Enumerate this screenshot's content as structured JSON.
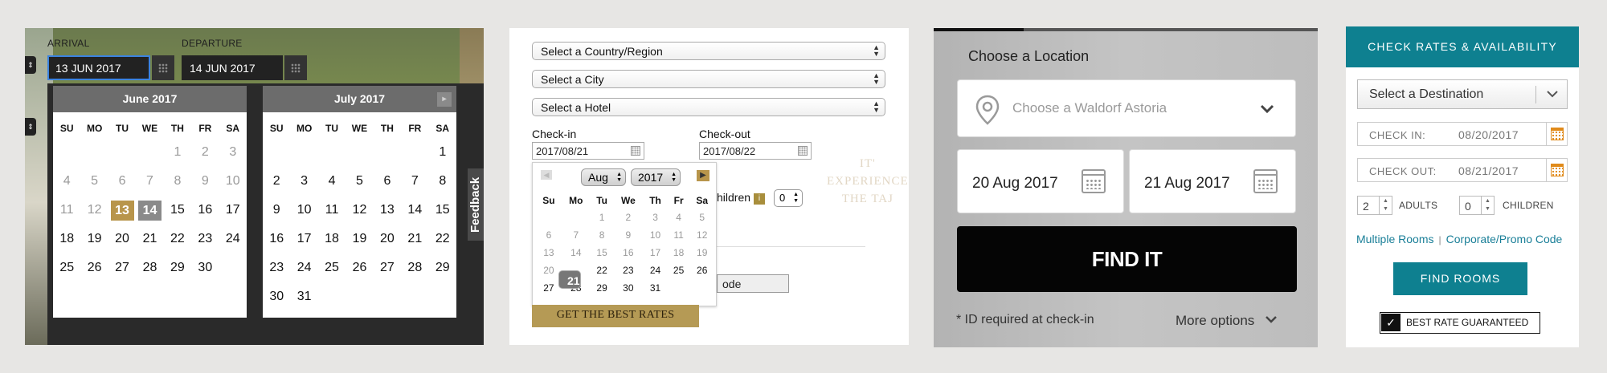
{
  "panel1": {
    "arrival_label": "ARRIVAL",
    "departure_label": "DEPARTURE",
    "arrival_value": "13 JUN 2017",
    "departure_value": "14 JUN 2017",
    "side_tab_glyph": "⇕",
    "feedback_label": "Feedback",
    "weekdays": [
      "SU",
      "MO",
      "TU",
      "WE",
      "TH",
      "FR",
      "SA"
    ],
    "june": {
      "title": "June 2017",
      "rows": [
        [
          "",
          "",
          "",
          "",
          "1",
          "2",
          "3"
        ],
        [
          "4",
          "5",
          "6",
          "7",
          "8",
          "9",
          "10"
        ],
        [
          "11",
          "12",
          "13",
          "14",
          "15",
          "16",
          "17"
        ],
        [
          "18",
          "19",
          "20",
          "21",
          "22",
          "23",
          "24"
        ],
        [
          "25",
          "26",
          "27",
          "28",
          "29",
          "30",
          ""
        ]
      ],
      "dim_upto": 12,
      "selected_arrival": "13",
      "selected_departure": "14"
    },
    "july": {
      "title": "July  2017",
      "next_glyph": "▸",
      "rows": [
        [
          "",
          "",
          "",
          "",
          "",
          "",
          "1"
        ],
        [
          "2",
          "3",
          "4",
          "5",
          "6",
          "7",
          "8"
        ],
        [
          "9",
          "10",
          "11",
          "12",
          "13",
          "14",
          "15"
        ],
        [
          "16",
          "17",
          "18",
          "19",
          "20",
          "21",
          "22"
        ],
        [
          "23",
          "24",
          "25",
          "26",
          "27",
          "28",
          "29"
        ],
        [
          "30",
          "31",
          "",
          "",
          "",
          "",
          ""
        ]
      ]
    }
  },
  "panel2": {
    "country_select": "Select a Country/Region",
    "city_select": "Select a City",
    "hotel_select": "Select a Hotel",
    "checkin_label": "Check-in",
    "checkout_label": "Check-out",
    "checkin_value": "2017/08/21",
    "checkout_value": "2017/08/22",
    "month_select": "Aug",
    "year_select": "2017",
    "weekdays": [
      "Su",
      "Mo",
      "Tu",
      "We",
      "Th",
      "Fr",
      "Sa"
    ],
    "rows": [
      [
        "",
        "",
        "1",
        "2",
        "3",
        "4",
        "5"
      ],
      [
        "6",
        "7",
        "8",
        "9",
        "10",
        "11",
        "12"
      ],
      [
        "13",
        "14",
        "15",
        "16",
        "17",
        "18",
        "19"
      ],
      [
        "20",
        "21",
        "22",
        "23",
        "24",
        "25",
        "26"
      ],
      [
        "27",
        "28",
        "29",
        "30",
        "31",
        "",
        ""
      ]
    ],
    "dim_upto": 20,
    "selected_day": "21",
    "children_label": "hildren",
    "info_glyph": "i",
    "children_value": "0",
    "code_label": "ode",
    "ghost_line1": "IT'",
    "ghost_line2": "EXPERIENCE",
    "ghost_line3": "THE TAJ",
    "best_rates_button": "GET THE BEST RATES"
  },
  "panel3": {
    "title": "Choose a Location",
    "location_placeholder": "Choose a Waldorf Astoria",
    "arrival_date": "20 Aug 2017",
    "departure_date": "21 Aug 2017",
    "find_button": "FIND IT",
    "id_note": "* ID required at check-in",
    "more_options": "More options"
  },
  "panel4": {
    "header": "CHECK RATES & AVAILABILITY",
    "destination": "Select a Destination",
    "checkin_label": "CHECK IN:",
    "checkin_value": "08/20/2017",
    "checkout_label": "CHECK OUT:",
    "checkout_value": "08/21/2017",
    "adults_value": "2",
    "adults_label": "ADULTS",
    "children_value": "0",
    "children_label": "CHILDREN",
    "multiple_rooms": "Multiple Rooms",
    "promo_link": "Corporate/Promo Code",
    "find_rooms": "FIND ROOMS",
    "best_rate": "BEST RATE GUARANTEED"
  },
  "colors": {
    "gold": "#b8954b",
    "teal": "#0e8090",
    "link": "#1a7f98",
    "orange": "#e08a1a"
  }
}
